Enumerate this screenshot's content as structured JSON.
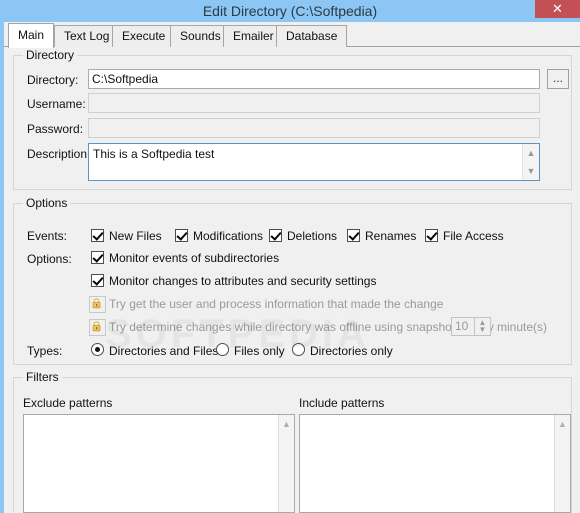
{
  "window": {
    "title": "Edit Directory (C:\\Softpedia)",
    "close_label": "✕",
    "titlebar_color": "#8cc6f5",
    "close_color": "#c25055"
  },
  "tabs": [
    {
      "label": "Main",
      "active": true
    },
    {
      "label": "Text Log",
      "active": false
    },
    {
      "label": "Execute",
      "active": false
    },
    {
      "label": "Sounds",
      "active": false
    },
    {
      "label": "Emailer",
      "active": false
    },
    {
      "label": "Database",
      "active": false
    }
  ],
  "directory_group": {
    "legend": "Directory",
    "fields": {
      "directory_label": "Directory:",
      "directory_value": "C:\\Softpedia",
      "browse_label": "...",
      "username_label": "Username:",
      "username_value": "",
      "password_label": "Password:",
      "password_value": "",
      "description_label": "Description:",
      "description_value": "This is a Softpedia test"
    }
  },
  "options_group": {
    "legend": "Options",
    "events_label": "Events:",
    "events": [
      {
        "label": "New Files",
        "checked": true
      },
      {
        "label": "Modifications",
        "checked": true
      },
      {
        "label": "Deletions",
        "checked": true
      },
      {
        "label": "Renames",
        "checked": true
      },
      {
        "label": "File Access",
        "checked": true
      }
    ],
    "options_label": "Options:",
    "options": [
      {
        "label": "Monitor events of subdirectories",
        "checked": true,
        "locked": false
      },
      {
        "label": "Monitor changes to attributes and security settings",
        "checked": true,
        "locked": false
      },
      {
        "label": "Try get the user and process information that made the change",
        "checked": false,
        "locked": true
      },
      {
        "label": "Try determine changes while directory was offline using snapshots every",
        "checked": false,
        "locked": true
      }
    ],
    "snapshot_interval": "10",
    "snapshot_units": "minute(s)",
    "types_label": "Types:",
    "types": [
      {
        "label": "Directories and Files",
        "selected": true
      },
      {
        "label": "Files only",
        "selected": false
      },
      {
        "label": "Directories only",
        "selected": false
      }
    ]
  },
  "filters_group": {
    "legend": "Filters",
    "exclude_label": "Exclude patterns",
    "exclude_items": [],
    "include_label": "Include patterns",
    "include_items": []
  },
  "watermark": {
    "text": "SOFTPEDIA"
  }
}
